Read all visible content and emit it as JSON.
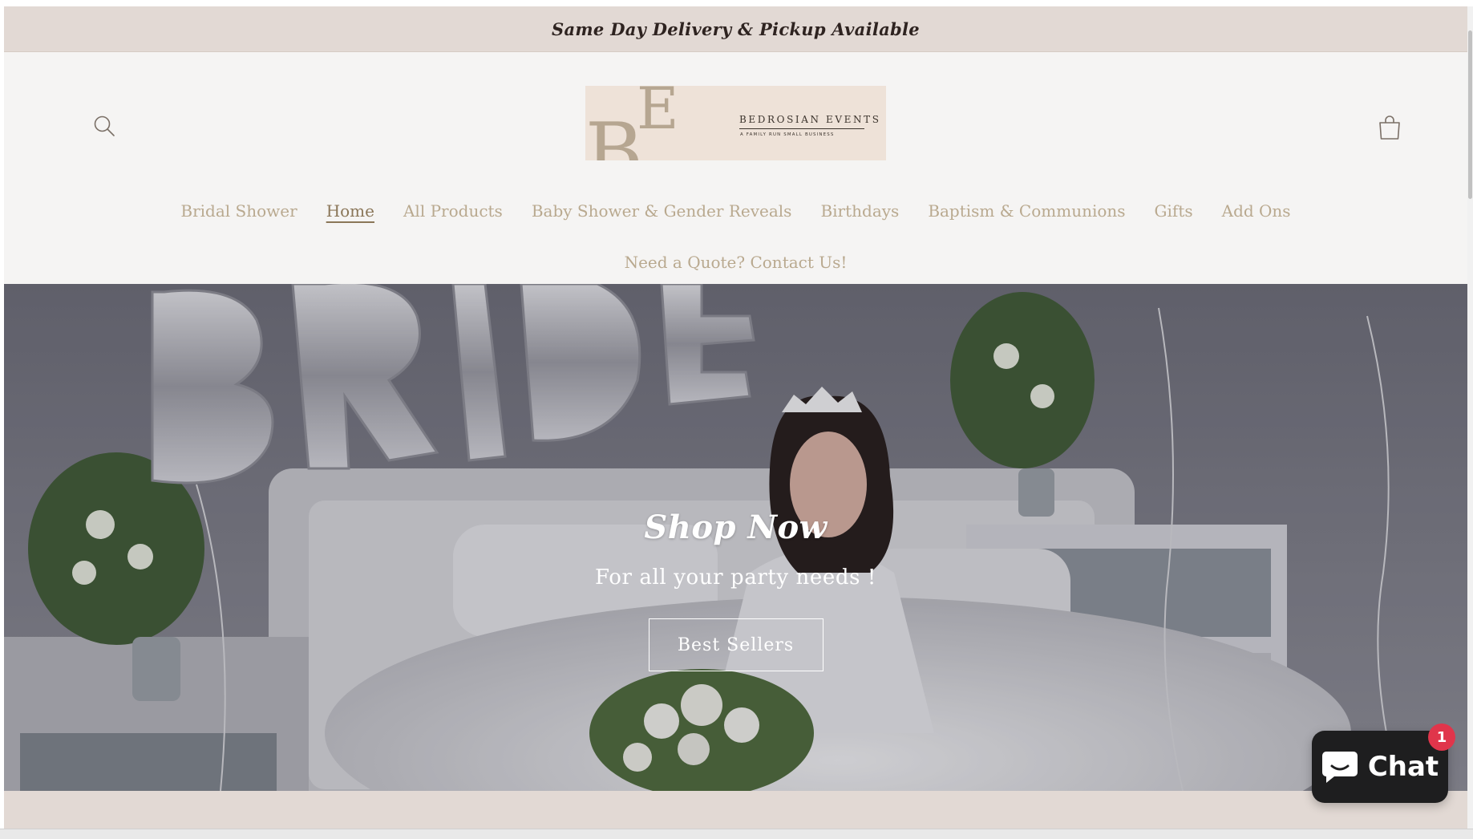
{
  "announcement": {
    "text": "Same Day Delivery & Pickup Available"
  },
  "header": {
    "search_icon": "search-icon",
    "cart_icon": "cart-icon",
    "logo": {
      "monogram": "BE",
      "wordmark": "BEDROSIAN EVENTS",
      "tagline": "A FAMILY RUN SMALL BUSINESS"
    }
  },
  "nav": {
    "items": [
      {
        "label": "Bridal Shower"
      },
      {
        "label": "Home",
        "active": true
      },
      {
        "label": "All Products"
      },
      {
        "label": "Baby Shower & Gender Reveals"
      },
      {
        "label": "Birthdays"
      },
      {
        "label": "Baptism & Communions"
      },
      {
        "label": "Gifts"
      },
      {
        "label": "Add Ons"
      }
    ],
    "secondary": {
      "label": "Need a Quote? Contact Us!"
    }
  },
  "hero": {
    "image_text": "BRIDE",
    "title": "Shop Now",
    "subtitle": "For all your party needs !",
    "button_label": "Best Sellers"
  },
  "chat": {
    "label": "Chat",
    "badge_count": "1",
    "icon": "chat-bubble-icon"
  },
  "colors": {
    "announcement_bg": "#e2d9d4",
    "nav_text": "#b9a98f",
    "logo_bg": "#eee2d8",
    "chat_bg": "#1e1e1f",
    "badge": "#e0354b"
  }
}
